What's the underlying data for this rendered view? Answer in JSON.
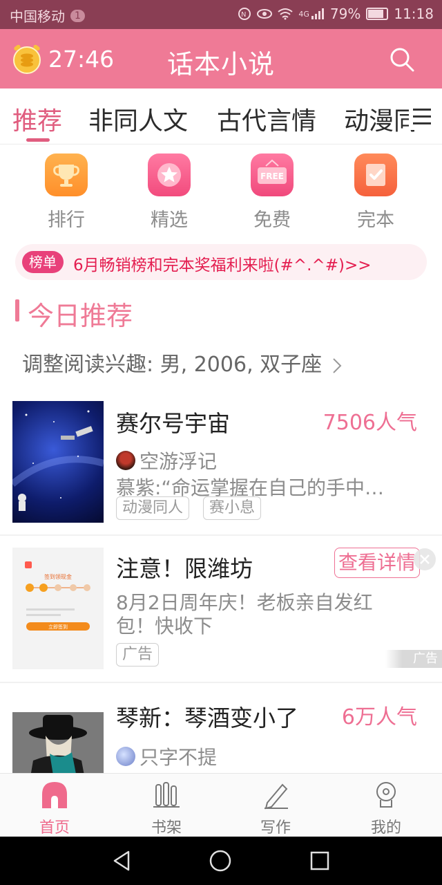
{
  "status_bar": {
    "carrier": "中国移动",
    "notif_count": "1",
    "network": "4G",
    "battery": "79%",
    "time": "11:18"
  },
  "header": {
    "timer": "27:46",
    "title": "话本小说",
    "search_icon": "search-icon",
    "timer_icon": "coin-clock-icon",
    "brand_color": "#ef7a96"
  },
  "tabs": [
    "推荐",
    "非同人文",
    "古代言情",
    "动漫同人"
  ],
  "quick_nav": [
    {
      "label": "排行",
      "icon": "trophy-icon"
    },
    {
      "label": "精选",
      "icon": "star-icon"
    },
    {
      "label": "免费",
      "icon": "free-sign-icon"
    },
    {
      "label": "完本",
      "icon": "check-book-icon"
    }
  ],
  "notice": {
    "badge": "榜单",
    "text": "6月畅销榜和完本奖福利来啦(#^.^#)>>"
  },
  "today": {
    "title": "今日推荐",
    "interest": "调整阅读兴趣: 男, 2006, 双子座"
  },
  "books": [
    {
      "title": "赛尔号宇宙",
      "popularity": "7506人气",
      "author": "空游浮记",
      "desc": "慕紫:“命运掌握在自己的手中…",
      "tags": [
        "动漫同人",
        "赛小息"
      ]
    },
    {
      "title": "琴新：琴酒变小了",
      "popularity": "6万人气",
      "author": "只字不提"
    }
  ],
  "ad": {
    "title": "注意！限潍坊",
    "desc_line1": "8月2日周年庆！老板亲自发红",
    "desc_line2": "包！快收下",
    "tag": "广告",
    "button": "查看详情",
    "corner": "广告",
    "cover_heading": "签到领现金",
    "cover_button": "立即签到"
  },
  "bottom_nav": [
    {
      "label": "首页",
      "icon": "home-icon",
      "active": true
    },
    {
      "label": "书架",
      "icon": "bookshelf-icon",
      "active": false
    },
    {
      "label": "写作",
      "icon": "pen-icon",
      "active": false
    },
    {
      "label": "我的",
      "icon": "profile-icon",
      "active": false
    }
  ]
}
